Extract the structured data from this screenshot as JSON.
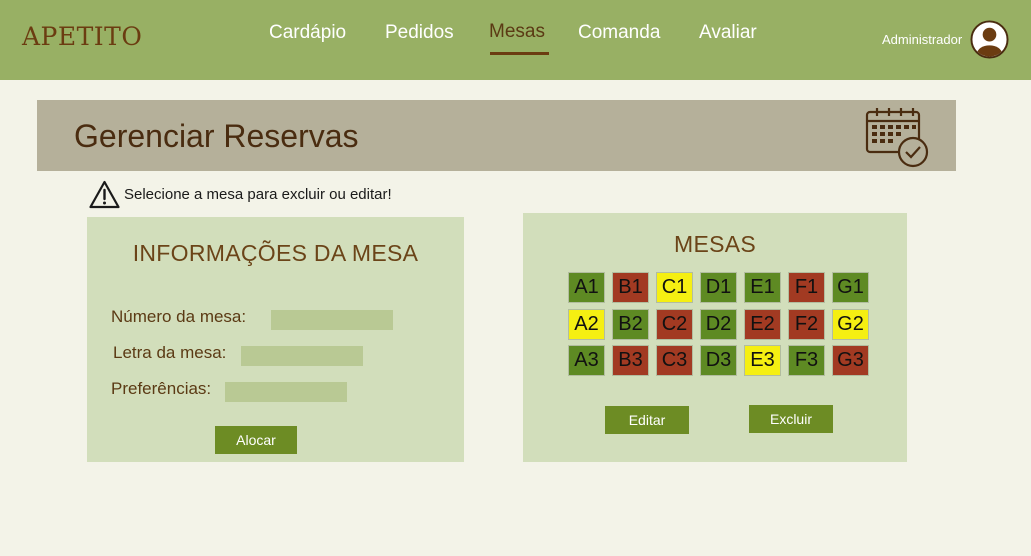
{
  "app": {
    "brand": "APETITO",
    "nav": [
      "Cardápio",
      "Pedidos",
      "Mesas",
      "Comanda",
      "Avaliar"
    ],
    "active_nav": "Mesas",
    "user_label": "Administrador"
  },
  "page": {
    "title": "Gerenciar Reservas",
    "warning": "Selecione a mesa para excluir ou editar!"
  },
  "info_panel": {
    "title": "INFORMAÇÕES DA MESA",
    "fields": [
      {
        "label": "Número da mesa:",
        "value": ""
      },
      {
        "label": "Letra da mesa:",
        "value": ""
      },
      {
        "label": "Preferências:",
        "value": ""
      }
    ],
    "button": "Alocar"
  },
  "tables_panel": {
    "title": "MESAS",
    "rows": [
      [
        {
          "id": "A1",
          "status": "green"
        },
        {
          "id": "B1",
          "status": "red"
        },
        {
          "id": "C1",
          "status": "yellow"
        },
        {
          "id": "D1",
          "status": "green"
        },
        {
          "id": "E1",
          "status": "green"
        },
        {
          "id": "F1",
          "status": "red"
        },
        {
          "id": "G1",
          "status": "green"
        }
      ],
      [
        {
          "id": "A2",
          "status": "yellow"
        },
        {
          "id": "B2",
          "status": "green"
        },
        {
          "id": "C2",
          "status": "red"
        },
        {
          "id": "D2",
          "status": "green"
        },
        {
          "id": "E2",
          "status": "red"
        },
        {
          "id": "F2",
          "status": "red"
        },
        {
          "id": "G2",
          "status": "yellow"
        }
      ],
      [
        {
          "id": "A3",
          "status": "green"
        },
        {
          "id": "B3",
          "status": "red"
        },
        {
          "id": "C3",
          "status": "red"
        },
        {
          "id": "D3",
          "status": "green"
        },
        {
          "id": "E3",
          "status": "yellow"
        },
        {
          "id": "F3",
          "status": "green"
        },
        {
          "id": "G3",
          "status": "red"
        }
      ]
    ],
    "edit_button": "Editar",
    "delete_button": "Excluir"
  },
  "colors": {
    "topbar": "#98b064",
    "accent": "#6d8c24",
    "green": "#5e8a23",
    "red": "#a23a22",
    "yellow": "#f5ef12"
  },
  "icons": [
    "user-avatar-icon",
    "calendar-check-icon",
    "warning-icon"
  ]
}
